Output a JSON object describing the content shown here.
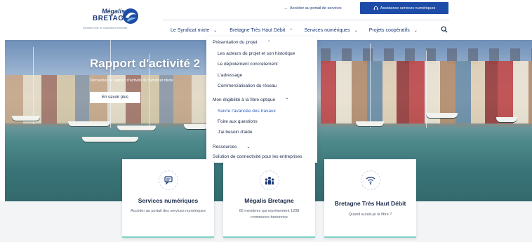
{
  "header": {
    "logo_line1": "Mégalis",
    "logo_line2": "BRETAGNE",
    "logo_tagline": "Syndicat mixte de coopération territoriale",
    "portal_link": "Accéder au portail de services",
    "assist_button": "Assistance services numériques"
  },
  "nav": {
    "items": [
      {
        "label": "Le Syndicat mixte",
        "chevron": "down"
      },
      {
        "label": "Bretagne Très Haut Débit",
        "chevron": "up"
      },
      {
        "label": "Services numériques",
        "chevron": "down"
      },
      {
        "label": "Projets coopératifs",
        "chevron": "down"
      }
    ]
  },
  "hero": {
    "title": "Rapport d'activité 2",
    "subtitle": "Découvrez le rapport d'activité du Syndicat mixte",
    "button": "En savoir plus"
  },
  "dropdown": {
    "section1": "Présentation du projet",
    "section1_items": [
      "Les acteurs du projet et son historique",
      "Le déploiement concrètement",
      "L'adressage",
      "Commercialisation du réseau"
    ],
    "section2": "Mon éligibilité à la fibre optique",
    "section2_items": [
      "Suivre l'avancée des travaux",
      "Foire aux questions",
      "J'ai besoin d'aide"
    ],
    "section3": "Ressources",
    "section4": "Solution de connectivité pour les entreprises"
  },
  "cards": [
    {
      "title": "Services numériques",
      "text": "Accéder au portail des services numériques",
      "icon": "chat-icon"
    },
    {
      "title": "Mégalis Bretagne",
      "text": "65 membres qui représentent 1208 communes bretonnes",
      "icon": "people-icon"
    },
    {
      "title": "Bretagne Très Haut Débit",
      "text": "Quand aurais-je la fibre ?",
      "icon": "wifi-icon"
    }
  ],
  "colors": {
    "brand": "#1d3a78",
    "button": "#1d4ca8",
    "active_link": "#2b5fc0",
    "card_accent": "#7fd3c6"
  }
}
